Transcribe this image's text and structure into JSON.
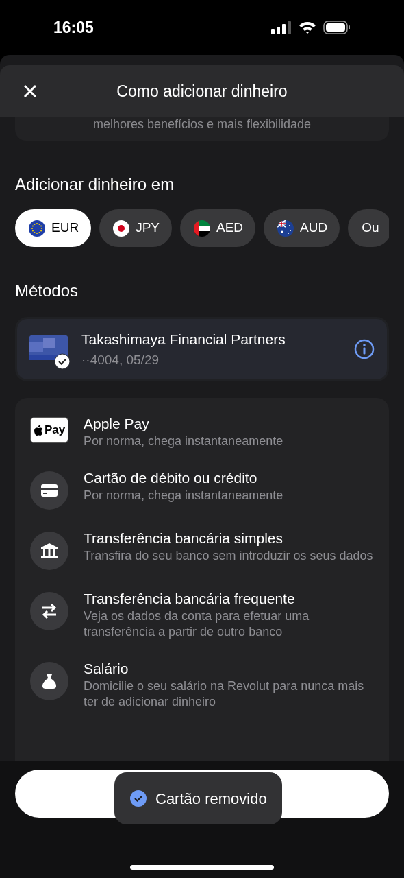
{
  "status_bar": {
    "time": "16:05"
  },
  "header": {
    "title": "Como adicionar dinheiro"
  },
  "behind_card": {
    "text": "melhores benefícios e mais flexibilidade"
  },
  "currency_section": {
    "title": "Adicionar dinheiro em",
    "currencies": [
      {
        "label": "EUR",
        "kind": "eu",
        "selected": true
      },
      {
        "label": "JPY",
        "kind": "jp",
        "selected": false
      },
      {
        "label": "AED",
        "kind": "ae",
        "selected": false
      },
      {
        "label": "AUD",
        "kind": "au",
        "selected": false
      },
      {
        "label": "Ou",
        "kind": "plain",
        "selected": false
      }
    ]
  },
  "methods_section": {
    "title": "Métodos",
    "saved_card": {
      "name": "Takashimaya Financial Partners",
      "details": "··4004, 05/29"
    },
    "methods": [
      {
        "kind": "applepay",
        "logo_text": "Pay",
        "title": "Apple Pay",
        "subtitle": "Por norma, chega instantaneamente"
      },
      {
        "kind": "card",
        "title": "Cartão de débito ou crédito",
        "subtitle": "Por norma, chega instantaneamente"
      },
      {
        "kind": "bank",
        "title": "Transferência bancária simples",
        "subtitle": "Transfira do seu banco sem introduzir os seus dados"
      },
      {
        "kind": "transfer",
        "title": "Transferência bancária frequente",
        "subtitle": "Veja os dados da conta para efetuar uma transferência a partir de outro banco"
      },
      {
        "kind": "salary",
        "title": "Salário",
        "subtitle": "Domicilie o seu salário na Revolut para nunca mais ter de adicionar dinheiro"
      }
    ]
  },
  "toast": {
    "text": "Cartão removido"
  }
}
